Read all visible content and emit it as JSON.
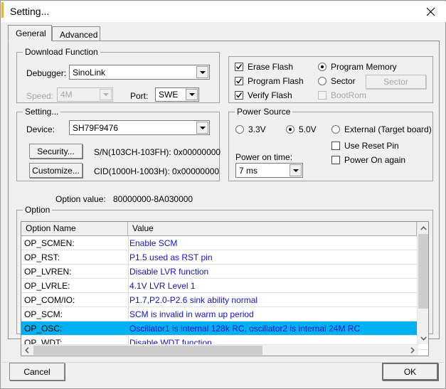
{
  "window": {
    "title": "Setting...",
    "close_icon": "close-icon"
  },
  "tabs": [
    {
      "label": "General",
      "active": true
    },
    {
      "label": "Advanced",
      "active": false
    }
  ],
  "download_function": {
    "legend": "Download Function",
    "debugger_label": "Debugger:",
    "debugger_value": "SinoLink",
    "speed_label": "Speed:",
    "speed_value": "4M",
    "port_label": "Port:",
    "port_value": "SWE",
    "checkboxes": [
      {
        "label": "Erase Flash",
        "checked": true,
        "disabled": false
      },
      {
        "label": "Program Flash",
        "checked": true,
        "disabled": false
      },
      {
        "label": "Verify Flash",
        "checked": true,
        "disabled": false
      }
    ],
    "radios": [
      {
        "label": "Program Memory",
        "selected": true,
        "disabled": false
      },
      {
        "label": "Sector",
        "selected": false,
        "disabled": false
      }
    ],
    "bootrom": {
      "label": "BootRom",
      "checked": false,
      "disabled": true
    },
    "sector_button": "Sector"
  },
  "setting": {
    "legend": "Setting...",
    "device_label": "Device:",
    "device_value": "SH79F9476",
    "security_button": "Security...",
    "customize_button": "Customize...",
    "sn_text": "S/N(103CH-103FH): 0x00000000",
    "cid_text": "CID(1000H-1003H): 0x00000000"
  },
  "power_source": {
    "legend": "Power Source",
    "radios": [
      {
        "label": "3.3V",
        "selected": false
      },
      {
        "label": "5.0V",
        "selected": true
      },
      {
        "label": "External (Target board)",
        "selected": false
      }
    ],
    "checkboxes": [
      {
        "label": "Use Reset Pin",
        "checked": false
      },
      {
        "label": "Power On again",
        "checked": false
      }
    ],
    "power_on_time_label": "Power on time:",
    "power_on_time_value": "7 ms"
  },
  "option_value": {
    "label": "Option value:",
    "value": "80000000-8A030000"
  },
  "option_group": {
    "legend": "Option",
    "columns": [
      "Option Name",
      "Value"
    ],
    "rows": [
      {
        "name": "OP_SCMEN:",
        "value": "Enable SCM",
        "selected": false
      },
      {
        "name": "OP_RST:",
        "value": "P1.5 used as RST pin",
        "selected": false
      },
      {
        "name": "OP_LVREN:",
        "value": "Disable LVR function",
        "selected": false
      },
      {
        "name": "OP_LVRLE:",
        "value": "4.1V LVR Level 1",
        "selected": false
      },
      {
        "name": "OP_COM/IO:",
        "value": "P1.7,P2.0-P2.6 sink ability normal",
        "selected": false
      },
      {
        "name": "OP_SCM:",
        "value": "SCM is invalid in warm up period",
        "selected": false
      },
      {
        "name": "OP_OSC:",
        "value": "Oscillator1 is internal 128k RC, oscillator2 is internal 24M RC",
        "selected": true
      },
      {
        "name": "OP_WDT:",
        "value": "Disable WDT function",
        "selected": false
      }
    ],
    "scroll": {
      "vertical_up_icon": "chevron-up-icon",
      "vertical_down_icon": "chevron-down-icon",
      "horizontal_left_icon": "chevron-left-icon",
      "horizontal_right_icon": "chevron-right-icon"
    }
  },
  "footer": {
    "cancel_label": "Cancel",
    "ok_label": "OK"
  },
  "colors": {
    "dialog_bg": "#f0f0f0",
    "selection": "#00b0f0",
    "value_text": "#1414c8",
    "accent": "#e8b23a"
  }
}
